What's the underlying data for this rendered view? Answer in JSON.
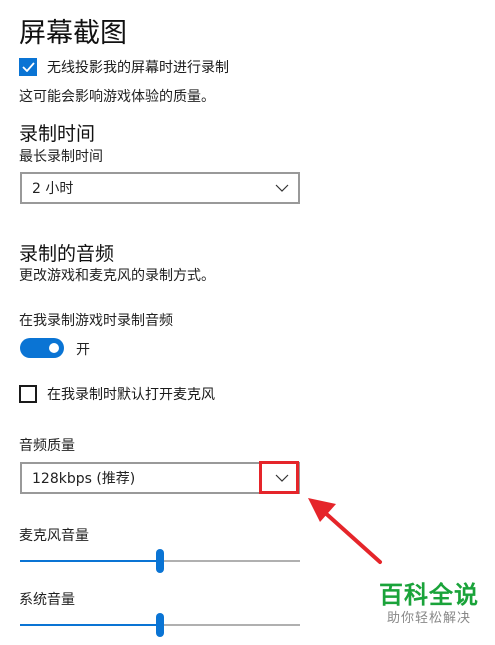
{
  "page": {
    "title": "屏幕截图"
  },
  "wireless_projection": {
    "label": "无线投影我的屏幕时进行录制",
    "checked": true,
    "note": "这可能会影响游戏体验的质量。"
  },
  "recording_time": {
    "heading": "录制时间",
    "label": "最长录制时间",
    "selected": "2 小时"
  },
  "recorded_audio": {
    "heading": "录制的音频",
    "description": "更改游戏和麦克风的录制方式。",
    "record_audio_label": "在我录制游戏时录制音频",
    "toggle_state": "开",
    "toggle_on": true,
    "mic_default_label": "在我录制时默认打开麦克风",
    "mic_default_checked": false
  },
  "audio_quality": {
    "label": "音频质量",
    "selected": "128kbps (推荐)"
  },
  "mic_volume": {
    "label": "麦克风音量",
    "level": 0.5
  },
  "system_volume": {
    "label": "系统音量",
    "level": 0.5
  },
  "watermark": {
    "main": "百科全说",
    "sub": "助你轻松解决"
  },
  "colors": {
    "accent": "#0a74d4",
    "annotation": "#e5252a",
    "watermark_green": "#1aa33a"
  },
  "icons": {
    "checkmark": "checkmark-icon",
    "chevron": "chevron-down-icon",
    "arrow": "annotation-arrow-icon"
  }
}
